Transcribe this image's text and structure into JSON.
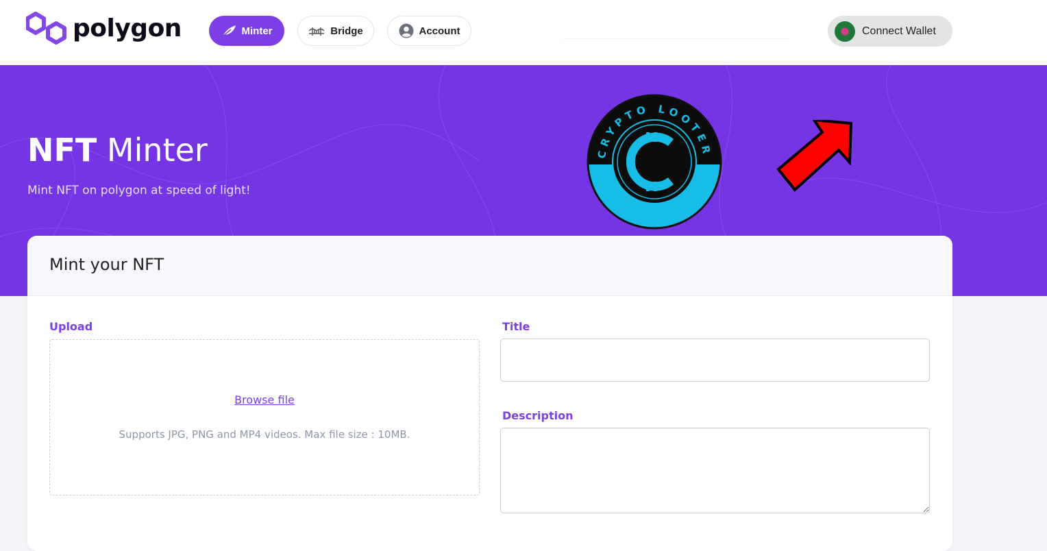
{
  "header": {
    "logo_text": "polygon",
    "nav": {
      "minter": "Minter",
      "bridge": "Bridge",
      "account": "Account"
    },
    "wallet_label": "Connect Wallet"
  },
  "hero": {
    "title_bold": "NFT",
    "title_rest": " Minter",
    "subtitle": "Mint NFT on polygon at speed of light!",
    "badge_text": "CRYPTO LOOTERS"
  },
  "form": {
    "card_title": "Mint your NFT",
    "upload_label": "Upload",
    "browse_label": "Browse file",
    "supports_text": "Supports JPG, PNG and MP4 videos. Max file size : 10MB.",
    "title_label": "Title",
    "title_value": "",
    "description_label": "Description",
    "description_value": ""
  },
  "colors": {
    "brand_purple": "#7d3ee6",
    "hero_purple": "#7535e4",
    "badge_cyan": "#17bde6",
    "arrow_red": "#ff0000"
  },
  "icons": {
    "logo": "polygon-logo-icon",
    "minter": "leaf-icon",
    "bridge": "bridge-icon",
    "account": "user-circle-icon",
    "wallet": "wallet-avatar-icon",
    "annotation": "red-arrow-icon"
  }
}
